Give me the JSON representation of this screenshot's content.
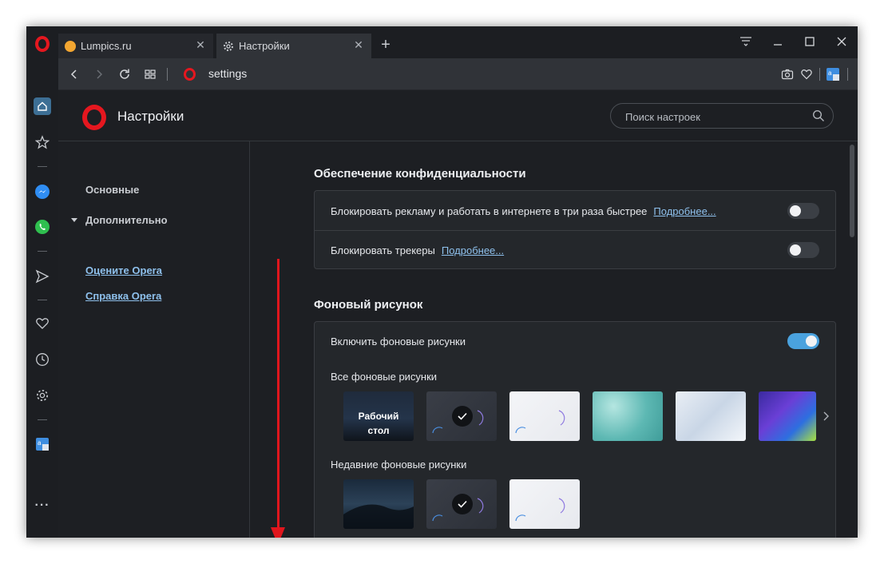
{
  "tabs": [
    {
      "label": "Lumpics.ru",
      "active": false
    },
    {
      "label": "Настройки",
      "active": true
    }
  ],
  "address_bar": {
    "url": "settings"
  },
  "header": {
    "title": "Настройки",
    "search_placeholder": "Поиск настроек"
  },
  "nav": {
    "main": "Основные",
    "advanced": "Дополнительно",
    "rate": "Оцените Opera",
    "help": "Справка Opera"
  },
  "privacy": {
    "title": "Обеспечение конфиденциальности",
    "block_ads_label": "Блокировать рекламу и работать в интернете в три раза быстрее",
    "block_ads_more": "Подробнее...",
    "block_ads_enabled": false,
    "block_trackers_label": "Блокировать трекеры",
    "block_trackers_more": "Подробнее...",
    "block_trackers_enabled": false
  },
  "wallpapers": {
    "title": "Фоновый рисунок",
    "enable_label": "Включить фоновые рисунки",
    "enabled": true,
    "all_label": "Все фоновые рисунки",
    "desktop_label": "Рабочий стол",
    "recent_label": "Недавние фоновые рисунки"
  },
  "colors": {
    "accent": "#4aa2de",
    "link": "#8ec0ec",
    "opera_red": "#e5171f",
    "annotation_arrow": "#e0161d"
  }
}
